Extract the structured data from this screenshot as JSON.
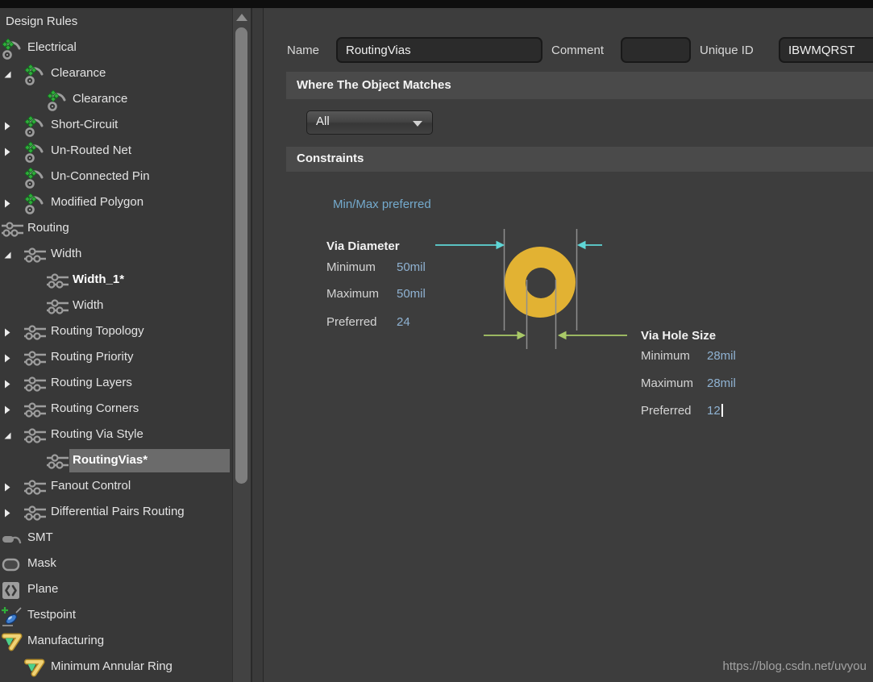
{
  "colors": {
    "value_blue": "#8fb2d2",
    "mode_blue": "#74aacd",
    "diagram_cyan": "#5fd6d6",
    "diagram_green": "#a9c968",
    "via_pad_yellow": "#e2b233",
    "selection_gray": "#6b6b6b"
  },
  "watermark": "https://blog.csdn.net/uvyou",
  "tree": {
    "items": [
      {
        "label": "Design Rules",
        "icon": "none",
        "level": 0,
        "expander": "none",
        "bold": false,
        "selected": false
      },
      {
        "label": "Electrical",
        "icon": "electrical",
        "level": 1,
        "expander": "none",
        "bold": false,
        "selected": false
      },
      {
        "label": "Clearance",
        "icon": "electrical",
        "level": 2,
        "expander": "expanded",
        "bold": false,
        "selected": false
      },
      {
        "label": "Clearance",
        "icon": "electrical",
        "level": 3,
        "expander": "none",
        "bold": false,
        "selected": false
      },
      {
        "label": "Short-Circuit",
        "icon": "electrical",
        "level": 2,
        "expander": "collapsed",
        "bold": false,
        "selected": false
      },
      {
        "label": "Un-Routed Net",
        "icon": "electrical",
        "level": 2,
        "expander": "collapsed",
        "bold": false,
        "selected": false
      },
      {
        "label": "Un-Connected Pin",
        "icon": "electrical",
        "level": 2,
        "expander": "none",
        "bold": false,
        "selected": false
      },
      {
        "label": "Modified Polygon",
        "icon": "electrical",
        "level": 2,
        "expander": "collapsed",
        "bold": false,
        "selected": false
      },
      {
        "label": "Routing",
        "icon": "routing",
        "level": 1,
        "expander": "none",
        "bold": false,
        "selected": false
      },
      {
        "label": "Width",
        "icon": "routing",
        "level": 2,
        "expander": "expanded",
        "bold": false,
        "selected": false
      },
      {
        "label": "Width_1*",
        "icon": "routing",
        "level": 3,
        "expander": "none",
        "bold": true,
        "selected": false
      },
      {
        "label": "Width",
        "icon": "routing",
        "level": 3,
        "expander": "none",
        "bold": false,
        "selected": false
      },
      {
        "label": "Routing Topology",
        "icon": "routing",
        "level": 2,
        "expander": "collapsed",
        "bold": false,
        "selected": false
      },
      {
        "label": "Routing Priority",
        "icon": "routing",
        "level": 2,
        "expander": "collapsed",
        "bold": false,
        "selected": false
      },
      {
        "label": "Routing Layers",
        "icon": "routing",
        "level": 2,
        "expander": "collapsed",
        "bold": false,
        "selected": false
      },
      {
        "label": "Routing Corners",
        "icon": "routing",
        "level": 2,
        "expander": "collapsed",
        "bold": false,
        "selected": false
      },
      {
        "label": "Routing Via Style",
        "icon": "routing",
        "level": 2,
        "expander": "expanded",
        "bold": false,
        "selected": false
      },
      {
        "label": "RoutingVias*",
        "icon": "routing",
        "level": 3,
        "expander": "none",
        "bold": true,
        "selected": true
      },
      {
        "label": "Fanout Control",
        "icon": "routing",
        "level": 2,
        "expander": "collapsed",
        "bold": false,
        "selected": false
      },
      {
        "label": "Differential Pairs Routing",
        "icon": "routing",
        "level": 2,
        "expander": "collapsed",
        "bold": false,
        "selected": false
      },
      {
        "label": "SMT",
        "icon": "smt",
        "level": 1,
        "expander": "none",
        "bold": false,
        "selected": false
      },
      {
        "label": "Mask",
        "icon": "mask",
        "level": 1,
        "expander": "none",
        "bold": false,
        "selected": false
      },
      {
        "label": "Plane",
        "icon": "plane",
        "level": 1,
        "expander": "none",
        "bold": false,
        "selected": false
      },
      {
        "label": "Testpoint",
        "icon": "testpoint",
        "level": 1,
        "expander": "none",
        "bold": false,
        "selected": false
      },
      {
        "label": "Manufacturing",
        "icon": "manufacturing",
        "level": 1,
        "expander": "none",
        "bold": false,
        "selected": false
      },
      {
        "label": "Minimum Annular Ring",
        "icon": "manufacturing",
        "level": 2,
        "expander": "none",
        "bold": false,
        "selected": false
      }
    ]
  },
  "header": {
    "name_label": "Name",
    "name_value": "RoutingVias",
    "comment_label": "Comment",
    "comment_value": "",
    "unique_id_label": "Unique ID",
    "unique_id_value": "IBWMQRST"
  },
  "where": {
    "title": "Where The Object Matches",
    "scope": "All"
  },
  "constraints": {
    "title": "Constraints",
    "mode": "Min/Max preferred",
    "via_diameter": {
      "title": "Via Diameter",
      "rows": [
        {
          "label": "Minimum",
          "value": "50mil"
        },
        {
          "label": "Maximum",
          "value": "50mil"
        },
        {
          "label": "Preferred",
          "value": "24"
        }
      ]
    },
    "via_hole": {
      "title": "Via Hole Size",
      "rows": [
        {
          "label": "Minimum",
          "value": "28mil"
        },
        {
          "label": "Maximum",
          "value": "28mil"
        },
        {
          "label": "Preferred",
          "value": "12"
        }
      ]
    }
  }
}
